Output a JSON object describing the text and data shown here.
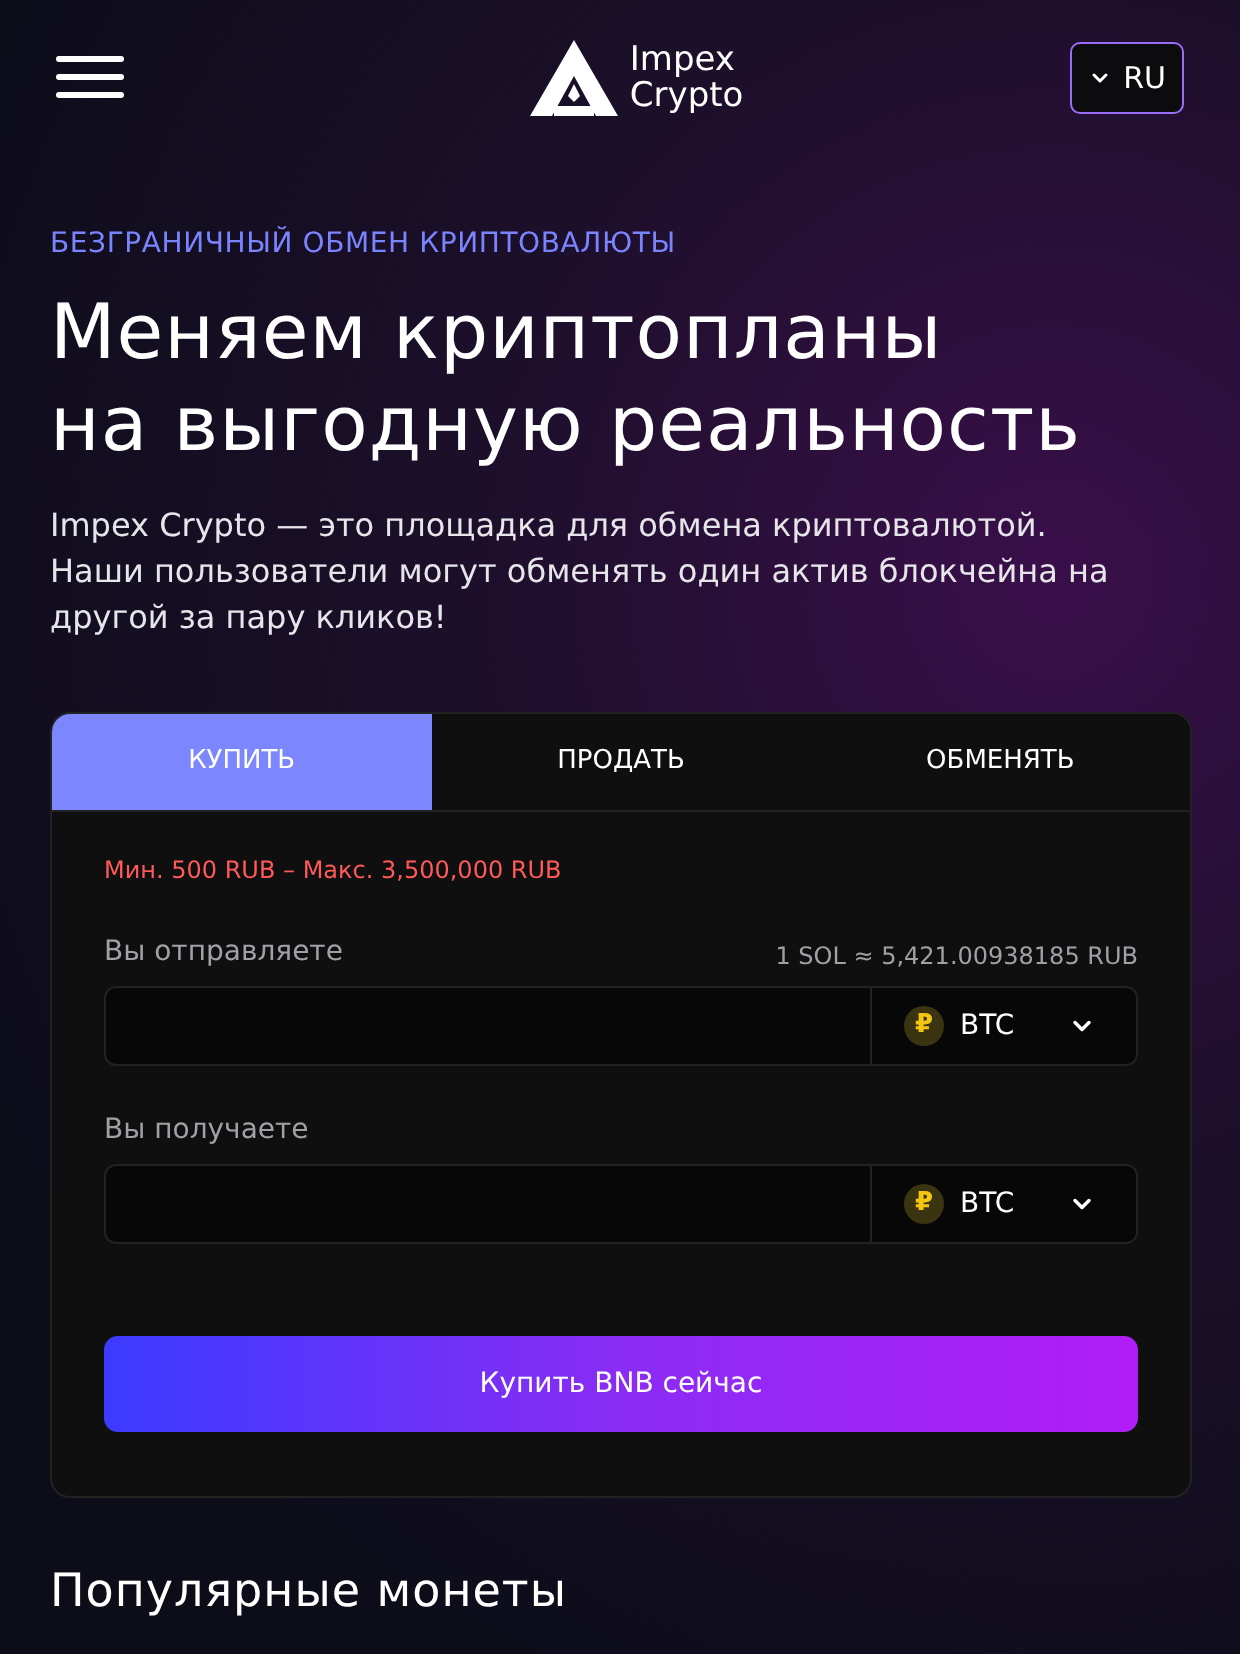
{
  "header": {
    "logo_line1": "Impex",
    "logo_line2": "Crypto",
    "language": "RU"
  },
  "hero": {
    "tagline": "БЕЗГРАНИЧНЫЙ ОБМЕН КРИПТОВАЛЮТЫ",
    "title_line1": "Меняем криптопланы",
    "title_line2": "на выгодную реальность",
    "description": "Impex Crypto — это площадка для обмена криптовалютой. Наши пользователи могут обменять один актив блокчейна на другой за пару кликов!"
  },
  "exchange": {
    "tabs": [
      {
        "label": "КУПИТЬ",
        "selected": true
      },
      {
        "label": "ПРОДАТЬ",
        "selected": false
      },
      {
        "label": "ОБМЕНЯТЬ",
        "selected": false
      }
    ],
    "limits": "Мин. 500 RUB – Макс. 3,500,000 RUB",
    "fields": [
      {
        "label": "Вы отправляете",
        "rate": "1 SOL ≈ 5,421.00938185 RUB",
        "currency": "BTC",
        "currency_symbol": "₽"
      },
      {
        "label": "Вы получаете",
        "currency": "BTC",
        "currency_symbol": "₽"
      }
    ],
    "submit": "Купить BNB сейчас"
  },
  "popular": {
    "title": "Популярные монеты"
  }
}
